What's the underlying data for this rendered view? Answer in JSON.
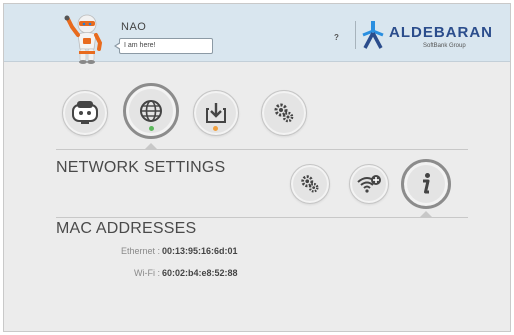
{
  "header": {
    "robot_name": "NAO",
    "speech_text": "I am here!",
    "help_label": "?",
    "brand": "ALDEBARAN",
    "brand_sub": "SoftBank Group",
    "brand_color": "#2b4d8c"
  },
  "nav": {
    "items": [
      {
        "name": "robot-settings",
        "icon": "robot-face-icon",
        "active": false
      },
      {
        "name": "network-settings",
        "icon": "globe-icon",
        "active": true,
        "status_color": "#5cb85c"
      },
      {
        "name": "updates",
        "icon": "download-icon",
        "active": false,
        "status_color": "#f0a040"
      },
      {
        "name": "advanced-settings",
        "icon": "gears-icon",
        "active": false
      }
    ]
  },
  "network": {
    "title": "NETWORK SETTINGS",
    "subnav": [
      {
        "name": "advanced",
        "icon": "gears-icon"
      },
      {
        "name": "wifi",
        "icon": "wifi-add-icon"
      },
      {
        "name": "info",
        "icon": "info-icon",
        "active": true
      }
    ]
  },
  "mac": {
    "title": "MAC ADDRESSES",
    "rows": [
      {
        "label": "Ethernet :",
        "value": "00:13:95:16:6d:01"
      },
      {
        "label": "Wi-Fi :",
        "value": "60:02:b4:e8:52:88"
      }
    ]
  }
}
